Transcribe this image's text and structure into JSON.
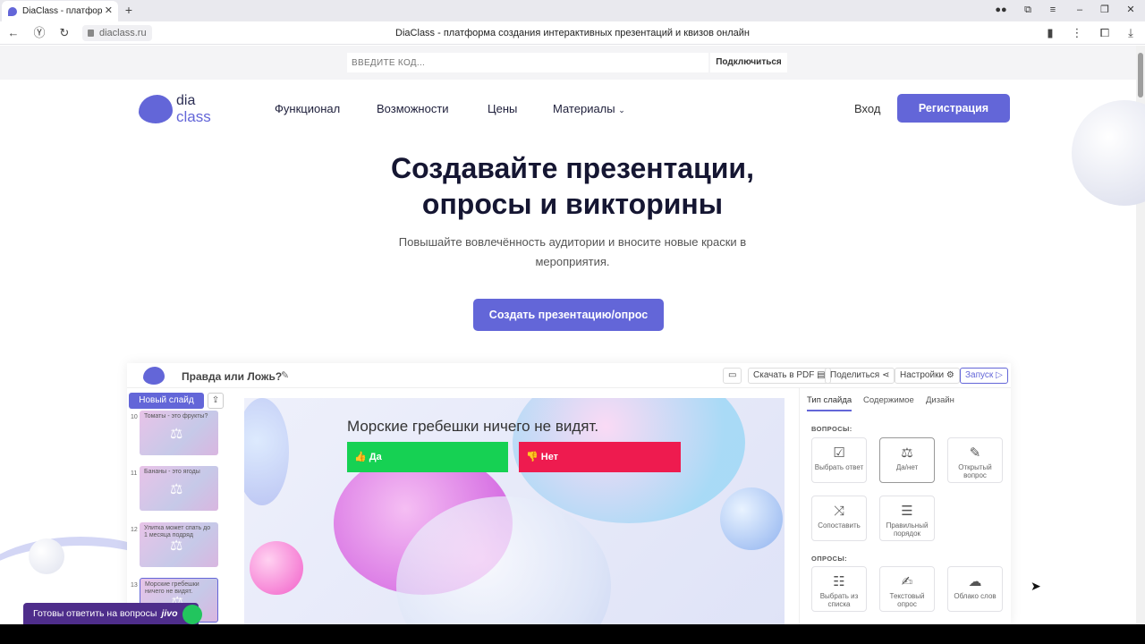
{
  "browser": {
    "tab_title": "DiaClass - платформа с",
    "tab_close": "✕",
    "new_tab": "+",
    "url": "diaclass.ru",
    "page_title": "DiaClass - платформа создания интерактивных презентаций и квизов онлайн"
  },
  "codebar": {
    "placeholder": "ВВЕДИТЕ КОД...",
    "connect_label": "Подключиться"
  },
  "header": {
    "logo_top": "dia",
    "logo_bottom": "class",
    "nav": [
      "Функционал",
      "Возможности",
      "Цены",
      "Материалы"
    ],
    "login_label": "Вход",
    "register_label": "Регистрация"
  },
  "hero": {
    "title_line1": "Создавайте презентации,",
    "title_line2": "опросы и викторины",
    "subtitle_line1": "Повышайте вовлечённость аудитории и вносите новые краски в",
    "subtitle_line2": "мероприятия.",
    "cta_label": "Создать презентацию/опрос"
  },
  "editor": {
    "title": "Правда или Ложь?",
    "toolbar": {
      "pdf_label": "Скачать в PDF",
      "share_label": "Поделиться",
      "settings_label": "Настройки",
      "launch_label": "Запуск"
    },
    "new_slide_label": "Новый слайд",
    "slides": [
      {
        "num": "10",
        "caption": "Томаты - это фрукты?"
      },
      {
        "num": "11",
        "caption": "Бананы - это ягоды"
      },
      {
        "num": "12",
        "caption": "Улитка может спать до 1 месяца подряд"
      },
      {
        "num": "13",
        "caption": "Морские гребешки ничего не видят."
      }
    ],
    "slide": {
      "question": "Морские гребешки ничего не видят.",
      "yes_label": "Да",
      "no_label": "Нет"
    },
    "panel": {
      "tabs": [
        "Тип слайда",
        "Содержимое",
        "Дизайн"
      ],
      "questions_heading": "ВОПРОСЫ:",
      "polls_heading": "ОПРОСЫ:",
      "question_types": [
        "Выбрать ответ",
        "Да/нет",
        "Открытый вопрос",
        "Сопоставить",
        "Правильный порядок"
      ],
      "poll_types": [
        "Выбрать из списка",
        "Текстовый опрос",
        "Облако слов"
      ]
    }
  },
  "chat": {
    "label": "Готовы ответить на вопросы",
    "brand": "jivo"
  },
  "colors": {
    "accent": "#6366d8",
    "yes": "#16d153",
    "no": "#ee1b4f",
    "chat": "#4e2d8b"
  }
}
